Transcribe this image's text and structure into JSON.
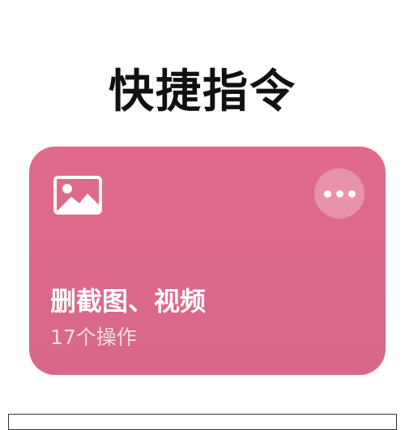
{
  "header": {
    "title": "快捷指令"
  },
  "shortcut_card": {
    "title": "删截图、视频",
    "subtitle": "17个操作",
    "icon": "photo-icon",
    "more_icon": "ellipsis-icon",
    "background_color": "#dd6a8b"
  }
}
